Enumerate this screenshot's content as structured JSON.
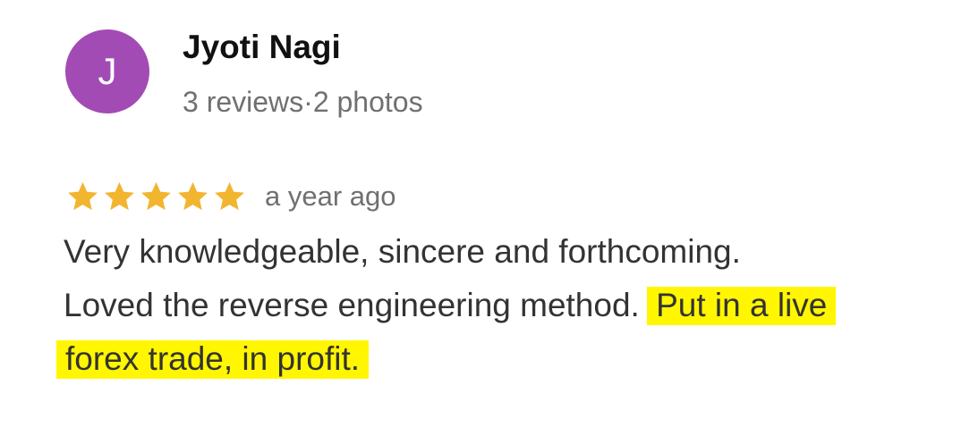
{
  "author": {
    "avatar_initial": "J",
    "avatar_color": "#a24bb5",
    "name": "Jyoti Nagi",
    "meta": "3 reviews·2 photos"
  },
  "review": {
    "rating": 5,
    "rating_max": 5,
    "star_color": "#f2b530",
    "time": "a year ago",
    "text_line1": "Very knowledgeable, sincere and forthcoming.",
    "text_line2_plain": "Loved the reverse engineering method.",
    "text_line2_highlight": "Put in a live",
    "text_line3_highlight": "forex trade, in profit.",
    "highlight_color": "#fff600"
  }
}
